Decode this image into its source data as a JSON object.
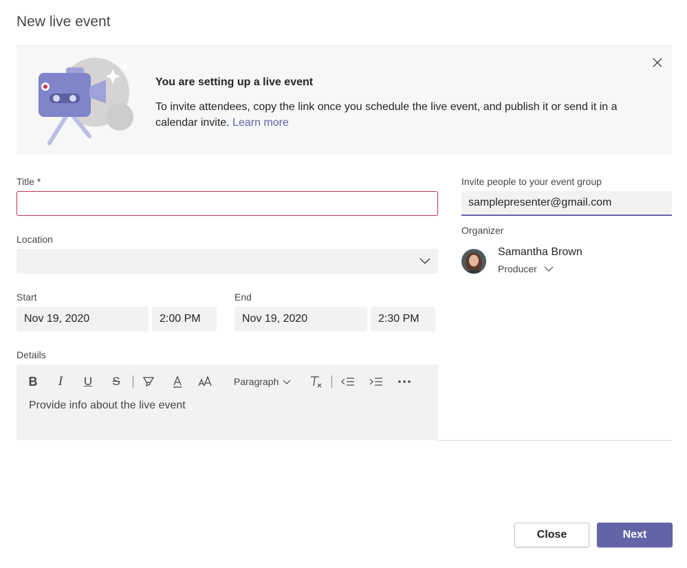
{
  "page_title": "New live event",
  "banner": {
    "heading": "You are setting up a live event",
    "text": "To invite attendees, copy the link once you schedule the live event, and publish it or send it in a calendar invite.",
    "link": "Learn more",
    "illustration_icon": "camera-illustration",
    "close_icon": "close-icon"
  },
  "form": {
    "title_label": "Title *",
    "title_value": "",
    "location_label": "Location",
    "location_value": "",
    "start_label": "Start",
    "start_date": "Nov 19, 2020",
    "start_time": "2:00 PM",
    "end_label": "End",
    "end_date": "Nov 19, 2020",
    "end_time": "2:30 PM",
    "details_label": "Details",
    "details_placeholder": "Provide info about the live event",
    "paragraph_label": "Paragraph"
  },
  "invite": {
    "label": "Invite people to your event group",
    "value": "samplepresenter@gmail.com"
  },
  "organizer": {
    "label": "Organizer",
    "name": "Samantha Brown",
    "role": "Producer"
  },
  "buttons": {
    "close": "Close",
    "next": "Next"
  },
  "colors": {
    "accent": "#6264a7",
    "error_border": "#c4314b",
    "field_bg": "#f3f2f1"
  }
}
